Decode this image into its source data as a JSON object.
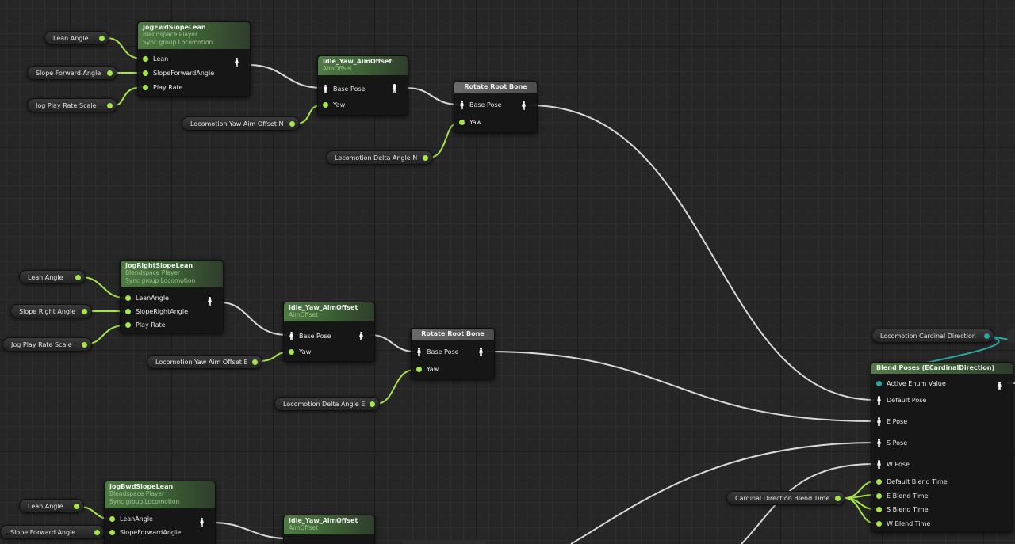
{
  "nodes": {
    "n1": {
      "title": "JogFwdSlopeLean",
      "line1": "Blendspace Player",
      "line2": "Sync group Locomotion",
      "pins": [
        "Lean",
        "SlopeForwardAngle",
        "Play Rate"
      ]
    },
    "n2": {
      "title": "Idle_Yaw_AimOffset",
      "line1": "AimOffset",
      "pins": [
        "Base Pose",
        "Yaw"
      ]
    },
    "n3": {
      "title": "Rotate Root Bone",
      "pins": [
        "Base Pose",
        "Yaw"
      ]
    },
    "n4": {
      "title": "JogRightSlopeLean",
      "line1": "Blendspace Player",
      "line2": "Sync group Locomotion",
      "pins": [
        "LeanAngle",
        "SlopeRightAngle",
        "Play Rate"
      ]
    },
    "n5": {
      "title": "Idle_Yaw_AimOffset",
      "line1": "AimOffset",
      "pins": [
        "Base Pose",
        "Yaw"
      ]
    },
    "n6": {
      "title": "Rotate Root Bone",
      "pins": [
        "Base Pose",
        "Yaw"
      ]
    },
    "n7": {
      "title": "JogBwdSlopeLean",
      "line1": "Blendspace Player",
      "line2": "Sync group Locomotion",
      "pins": [
        "LeanAngle",
        "SlopeForwardAngle"
      ]
    },
    "n8": {
      "title": "Idle_Yaw_AimOffset",
      "line1": "AimOffset"
    },
    "blend": {
      "title": "Blend Poses (ECardinalDirection)",
      "pins": [
        "Active Enum Value",
        "Default Pose",
        "E Pose",
        "S Pose",
        "W Pose",
        "Default Blend Time",
        "E Blend Time",
        "S Blend Time",
        "W Blend Time"
      ]
    }
  },
  "variables": {
    "v1": "Lean Angle",
    "v2": "Slope Forward Angle",
    "v3": "Jog Play Rate Scale",
    "v4": "Locomotion Yaw Aim Offset N",
    "v5": "Locomotion Delta Angle N",
    "v6": "Lean Angle",
    "v7": "Slope Right Angle",
    "v8": "Jog Play Rate Scale",
    "v9": "Locomotion Yaw Aim Offset E",
    "v10": "Locomotion Delta Angle E",
    "v11": "Lean Angle",
    "v12": "Slope Forward Angle",
    "v13": "Locomotion Cardinal Direction",
    "v14": "Cardinal Direction Blend Time"
  },
  "colors": {
    "float_pin": "#a6e64c",
    "enum_pin": "#2aa8a0",
    "pose_wire": "#d9d9d9",
    "float_wire": "#9ee04a"
  }
}
